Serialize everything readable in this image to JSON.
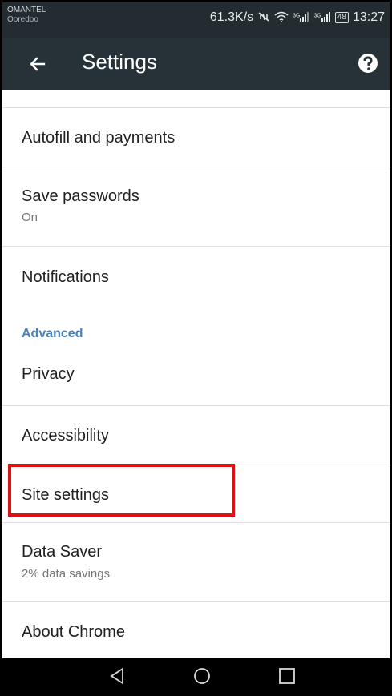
{
  "status_bar": {
    "carrier_primary": "OMANTEL",
    "carrier_secondary": "Ooredoo",
    "speed": "61.3K/s",
    "signal_1": "3G",
    "signal_2": "3G",
    "battery": "48",
    "time": "13:27"
  },
  "app_bar": {
    "title": "Settings",
    "back_icon": "arrow-left-icon",
    "help_icon": "help-circle-icon"
  },
  "settings": {
    "autofill": {
      "label": "Autofill and payments"
    },
    "save_passwords": {
      "label": "Save passwords",
      "subtitle": "On"
    },
    "notifications": {
      "label": "Notifications"
    },
    "advanced_header": "Advanced",
    "privacy": {
      "label": "Privacy"
    },
    "accessibility": {
      "label": "Accessibility"
    },
    "site_settings": {
      "label": "Site settings"
    },
    "data_saver": {
      "label": "Data Saver",
      "subtitle": "2% data savings"
    },
    "about_chrome": {
      "label": "About Chrome"
    }
  },
  "highlight_color": "#e01010",
  "accent_color": "#4a7fc1"
}
